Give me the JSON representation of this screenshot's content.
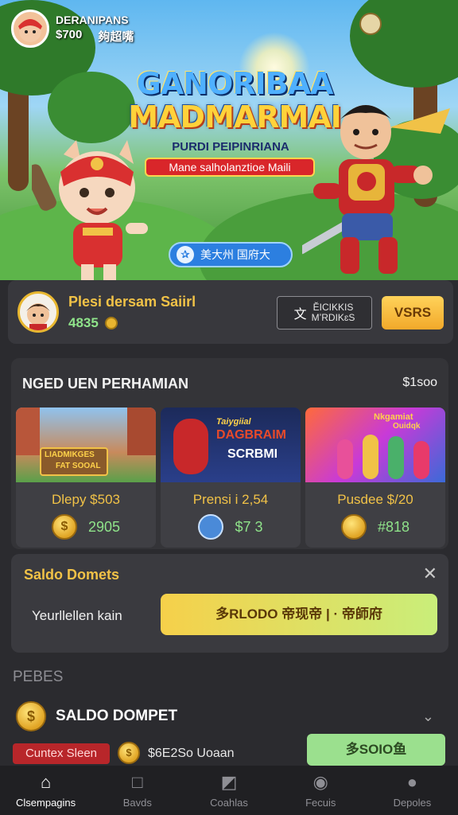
{
  "topbar": {
    "name": "DERANIPANS",
    "stat_coins": "$700",
    "stat_other": "夠超嘴"
  },
  "hero": {
    "title_line1": "GANORIBAA",
    "title_line2": "MADMARMAI",
    "subtitle": "PURDI PEIPINRIANA",
    "tagline": "Mane salholanztioe Maili",
    "pill_text": "美大州 国府大"
  },
  "profile": {
    "name": "Plesi dersam Saiirl",
    "coins": "4835",
    "lang_icon": "文",
    "lang_label_line1": "ĔICIKKIS",
    "lang_label_line2": "MʼRDIKɛS",
    "action_label": "VSRS"
  },
  "games": {
    "title": "NGED UEN PERHAMIAN",
    "total": "$1soo",
    "items": [
      {
        "thumb_text_1": "LIADMIKGES",
        "thumb_text_2": "FAT SOOAL",
        "price": "Dlepy $503",
        "coin_glyph": "$",
        "count": "2905"
      },
      {
        "thumb_text_1": "Taiygiial",
        "thumb_text_2": "DAGBRAIM",
        "thumb_text_3": "SCRBMI",
        "price": "Prensi i 2,54",
        "coin_glyph": "",
        "count": "$7  3"
      },
      {
        "thumb_text_1": "Nkgamiat",
        "thumb_text_2": "Ouidqk",
        "price": "Pusdee $/20",
        "coin_glyph": "",
        "count": "#818"
      }
    ]
  },
  "saldo_panel": {
    "title": "Saldo Domets",
    "close": "✕",
    "label": "Yeurllellen kain",
    "button": "多RLODO 帝现帝 | · 帝師府"
  },
  "section_label": "PEBES",
  "dompet": {
    "coin_glyph": "$",
    "title": "SALDO DOMPET",
    "chevron": "⌄"
  },
  "bottom_row": {
    "badge": "Cuntex Sleen",
    "coin_glyph": "$",
    "text": "$6E2So Uoaan",
    "button": "多SOIO鱼"
  },
  "nav": [
    {
      "icon": "home-icon",
      "glyph": "⌂",
      "label": "Clsempagins"
    },
    {
      "icon": "cards-icon",
      "glyph": "□",
      "label": "Bavds"
    },
    {
      "icon": "image-icon",
      "glyph": "◩",
      "label": "Coahlas"
    },
    {
      "icon": "focus-icon",
      "glyph": "◉",
      "label": "Fecuis"
    },
    {
      "icon": "user-icon",
      "glyph": "●",
      "label": "Depoles"
    }
  ],
  "colors": {
    "background": "#2b2b2f",
    "accent_gold": "#f1c247",
    "accent_green": "#8fe38a",
    "danger_red": "#b8262a"
  }
}
